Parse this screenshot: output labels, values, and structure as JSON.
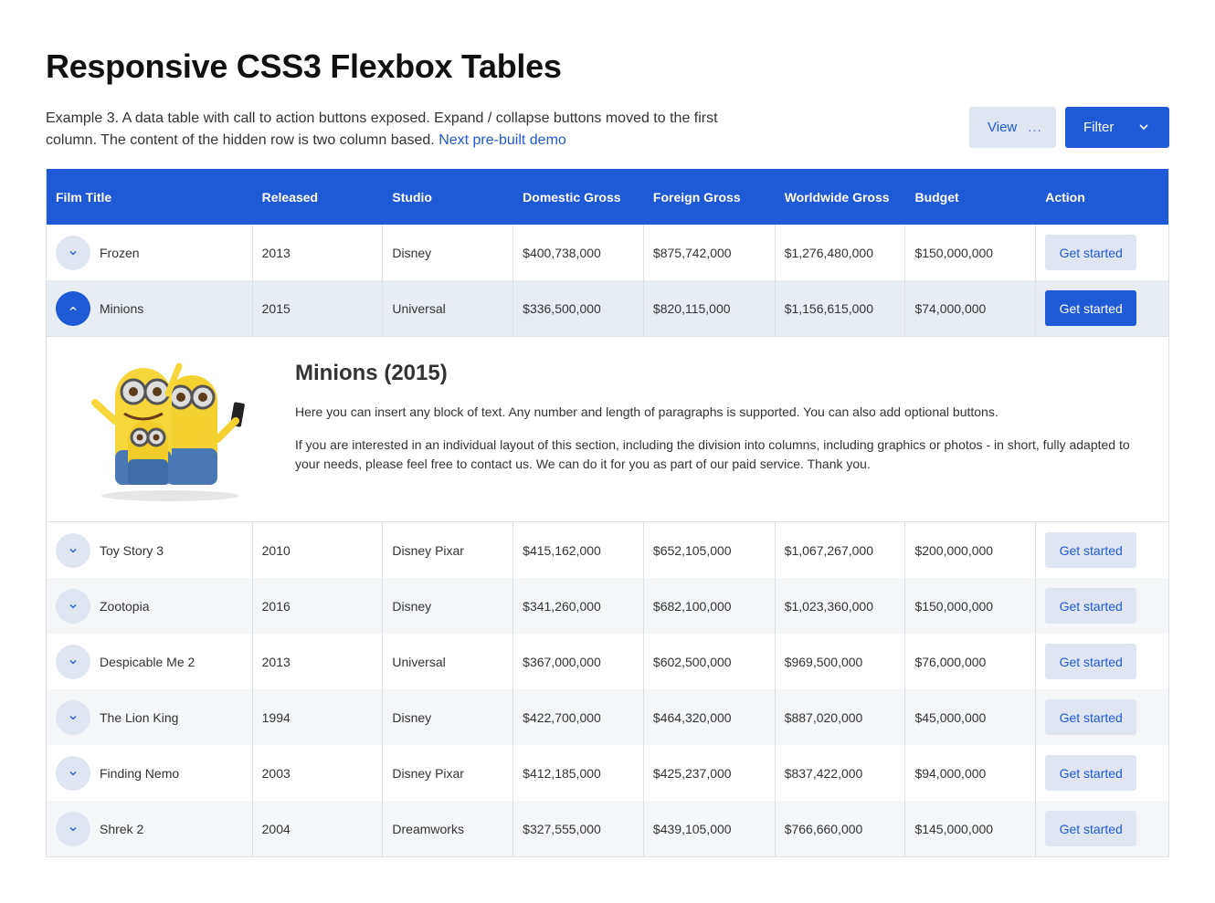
{
  "page": {
    "title": "Responsive CSS3 Flexbox Tables",
    "intro_text": "Example 3. A data table with call to action buttons exposed. Expand / collapse buttons moved to the first column. The content of the hidden row is two column based.",
    "intro_link": "Next pre-built demo"
  },
  "toolbar": {
    "view_label": "View",
    "view_dots": "...",
    "filter_label": "Filter"
  },
  "table": {
    "headers": [
      "Film Title",
      "Released",
      "Studio",
      "Domestic Gross",
      "Foreign Gross",
      "Worldwide Gross",
      "Budget",
      "Action"
    ],
    "action_label": "Get started",
    "rows": [
      {
        "title": "Frozen",
        "released": "2013",
        "studio": "Disney",
        "domestic": "$400,738,000",
        "foreign": "$875,742,000",
        "worldwide": "$1,276,480,000",
        "budget": "$150,000,000"
      },
      {
        "title": "Minions",
        "released": "2015",
        "studio": "Universal",
        "domestic": "$336,500,000",
        "foreign": "$820,115,000",
        "worldwide": "$1,156,615,000",
        "budget": "$74,000,000"
      },
      {
        "title": "Toy Story 3",
        "released": "2010",
        "studio": "Disney Pixar",
        "domestic": "$415,162,000",
        "foreign": "$652,105,000",
        "worldwide": "$1,067,267,000",
        "budget": "$200,000,000"
      },
      {
        "title": "Zootopia",
        "released": "2016",
        "studio": "Disney",
        "domestic": "$341,260,000",
        "foreign": "$682,100,000",
        "worldwide": "$1,023,360,000",
        "budget": "$150,000,000"
      },
      {
        "title": "Despicable Me 2",
        "released": "2013",
        "studio": "Universal",
        "domestic": "$367,000,000",
        "foreign": "$602,500,000",
        "worldwide": "$969,500,000",
        "budget": "$76,000,000"
      },
      {
        "title": "The Lion King",
        "released": "1994",
        "studio": "Disney",
        "domestic": "$422,700,000",
        "foreign": "$464,320,000",
        "worldwide": "$887,020,000",
        "budget": "$45,000,000"
      },
      {
        "title": "Finding Nemo",
        "released": "2003",
        "studio": "Disney Pixar",
        "domestic": "$412,185,000",
        "foreign": "$425,237,000",
        "worldwide": "$837,422,000",
        "budget": "$94,000,000"
      },
      {
        "title": "Shrek 2",
        "released": "2004",
        "studio": "Dreamworks",
        "domestic": "$327,555,000",
        "foreign": "$439,105,000",
        "worldwide": "$766,660,000",
        "budget": "$145,000,000"
      }
    ],
    "expanded_row_index": 1
  },
  "detail": {
    "heading": "Minions (2015)",
    "paragraph1": "Here you can insert any block of text. Any number and length of paragraphs is supported. You can also add optional buttons.",
    "paragraph2": "If you are interested in an individual layout of this section, including the division into columns, including graphics or photos - in short, fully adapted to your needs, please feel free to contact us. We can do it for you as part of our paid service. Thank you."
  },
  "colors": {
    "accent": "#1f5ad6",
    "soft_button": "#dfe6f1",
    "row_alt": "#f5f6f8",
    "row_active": "#e8ecf3"
  }
}
